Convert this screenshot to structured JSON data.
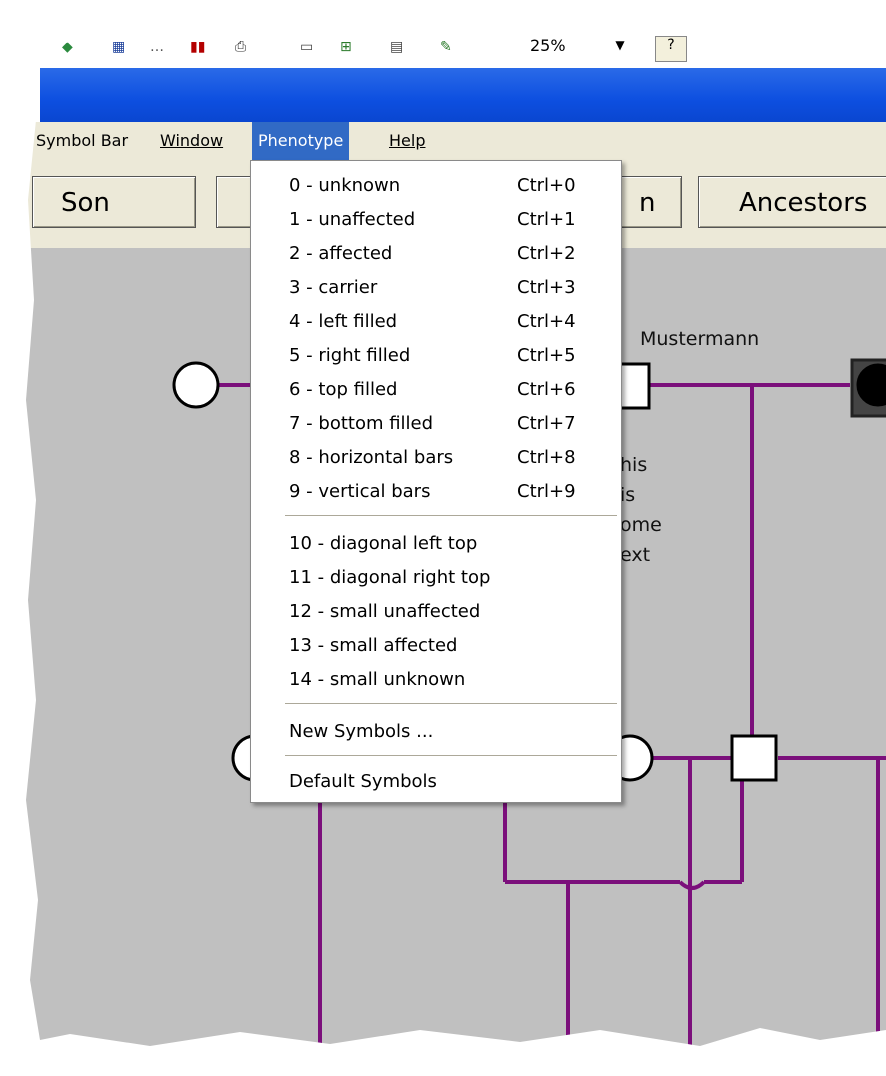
{
  "toolbar": {
    "zoom_value": "25%",
    "zoom_dropdown_icon": "chevron-down-icon",
    "help_icon": "help-icon"
  },
  "menubar": {
    "items": [
      {
        "label": "Symbol Bar"
      },
      {
        "label": "Window"
      },
      {
        "label": "Phenotype"
      },
      {
        "label": "Help"
      }
    ]
  },
  "buttons": {
    "son": "Son",
    "hidden": "n",
    "ancestors": "Ancestors"
  },
  "canvas": {
    "surname": "Mustermann",
    "note_lines": [
      "his",
      "is",
      "ome",
      "ext"
    ],
    "line_color": "#7b0f7b"
  },
  "phenotype_menu": {
    "group1": [
      {
        "label": "0 - unknown",
        "shortcut": "Ctrl+0"
      },
      {
        "label": "1 - unaffected",
        "shortcut": "Ctrl+1"
      },
      {
        "label": "2 - affected",
        "shortcut": "Ctrl+2"
      },
      {
        "label": "3 - carrier",
        "shortcut": "Ctrl+3"
      },
      {
        "label": "4 - left filled",
        "shortcut": "Ctrl+4"
      },
      {
        "label": "5 - right filled",
        "shortcut": "Ctrl+5"
      },
      {
        "label": "6 - top filled",
        "shortcut": "Ctrl+6"
      },
      {
        "label": "7 - bottom filled",
        "shortcut": "Ctrl+7"
      },
      {
        "label": "8 - horizontal bars",
        "shortcut": "Ctrl+8"
      },
      {
        "label": "9 - vertical bars",
        "shortcut": "Ctrl+9"
      }
    ],
    "group2": [
      {
        "label": "10 - diagonal left top"
      },
      {
        "label": "11 - diagonal right top"
      },
      {
        "label": "12 - small unaffected"
      },
      {
        "label": "13 - small affected"
      },
      {
        "label": "14 - small unknown"
      }
    ],
    "new_symbols": "New Symbols ...",
    "default_symbols": "Default Symbols"
  }
}
